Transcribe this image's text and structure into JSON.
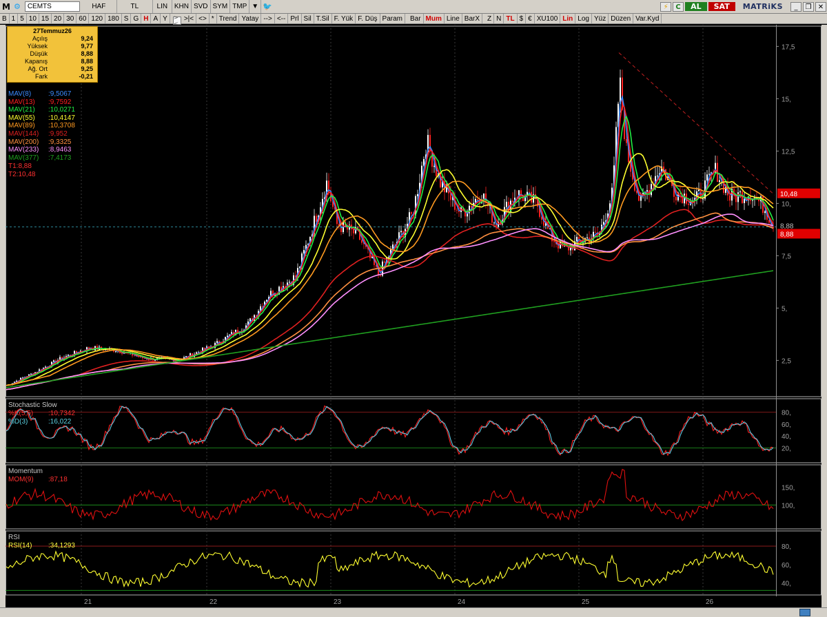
{
  "toolbar1": {
    "logo": "M",
    "symbol": "CEMTS",
    "items": [
      "HAF",
      "TL",
      "LIN",
      "KHN",
      "SVD",
      "SYM",
      "TMP"
    ],
    "al_label": "AL",
    "sat_label": "SAT",
    "brand": "MATRiKS"
  },
  "toolbar2": {
    "periods": [
      "B",
      "1",
      "5",
      "10",
      "15",
      "20",
      "30",
      "60",
      "120",
      "180",
      "S",
      "G",
      "H",
      "A",
      "Y"
    ],
    "nav": [
      ">|<",
      "<>",
      "*"
    ],
    "tools": [
      "Trend",
      "Yatay",
      "-->",
      "<--",
      "Prl",
      "Sil",
      "T.Sil",
      "F. Yük",
      "F. Düş",
      "Param"
    ],
    "styles": [
      "Bar",
      "Mum",
      "Line",
      "BarX"
    ],
    "extra": [
      "Z",
      "N",
      "TL",
      "$",
      "€",
      "XU100",
      "Lin",
      "Log",
      "Yüz",
      "Düzen",
      "Var.Kyd"
    ]
  },
  "info": {
    "date": "27Temmuz26",
    "rows": [
      {
        "k": "Açılış",
        "v": "9,24"
      },
      {
        "k": "Yüksek",
        "v": "9,77"
      },
      {
        "k": "Düşük",
        "v": "8,88"
      },
      {
        "k": "Kapanış",
        "v": "8,88"
      },
      {
        "k": "Ağ. Ort",
        "v": "9,25"
      },
      {
        "k": "Fark",
        "v": "-0,21"
      }
    ]
  },
  "mavs": [
    {
      "name": "MAV(8)",
      "value": ":9,5067",
      "color": "#3a8cff"
    },
    {
      "name": "MAV(13)",
      "value": ":9,7592",
      "color": "#ff2020"
    },
    {
      "name": "MAV(21)",
      "value": ":10,0271",
      "color": "#22ee44"
    },
    {
      "name": "MAV(55)",
      "value": ":10,4147",
      "color": "#ffff30"
    },
    {
      "name": "MAV(89)",
      "value": ":10,3708",
      "color": "#ff9a20"
    },
    {
      "name": "MAV(144)",
      "value": ":9,952",
      "color": "#e02020"
    },
    {
      "name": "MAV(200)",
      "value": ":9,3325",
      "color": "#ff9040"
    },
    {
      "name": "MAV(233)",
      "value": ":8,9463",
      "color": "#ff90ff"
    },
    {
      "name": "MAV(377)",
      "value": ":7,4173",
      "color": "#20a020"
    }
  ],
  "targets": [
    "T1:8,88",
    "T2:10,48"
  ],
  "price_axis": [
    "17,5",
    "15,",
    "12,5",
    "10,",
    "7,5",
    "5,",
    "2,5"
  ],
  "price_tags": {
    "upper": "10,48",
    "last": "8,88",
    "lower": "8,88"
  },
  "stoch": {
    "title": "Stochastic Slow",
    "k": "%K(5,5)",
    "k_val": ":10,7342",
    "d": "%D(3)",
    "d_val": ":16,022",
    "axis": [
      "80,",
      "60,",
      "40,",
      "20,"
    ]
  },
  "momentum": {
    "title": "Momentum",
    "name": "MOM(9)",
    "value": ":87,18",
    "axis": [
      "150,",
      "100,"
    ]
  },
  "rsi": {
    "title": "RSI",
    "name": "RSI(14)",
    "value": ":34,1293",
    "axis": [
      "80,",
      "60,",
      "40,"
    ]
  },
  "x_axis": [
    "21",
    "22",
    "23",
    "24",
    "25",
    "26"
  ],
  "colors": {
    "up": "#ffffff",
    "down": "#ff2020",
    "bg": "#000000",
    "grid": "#2a2a2a"
  }
}
